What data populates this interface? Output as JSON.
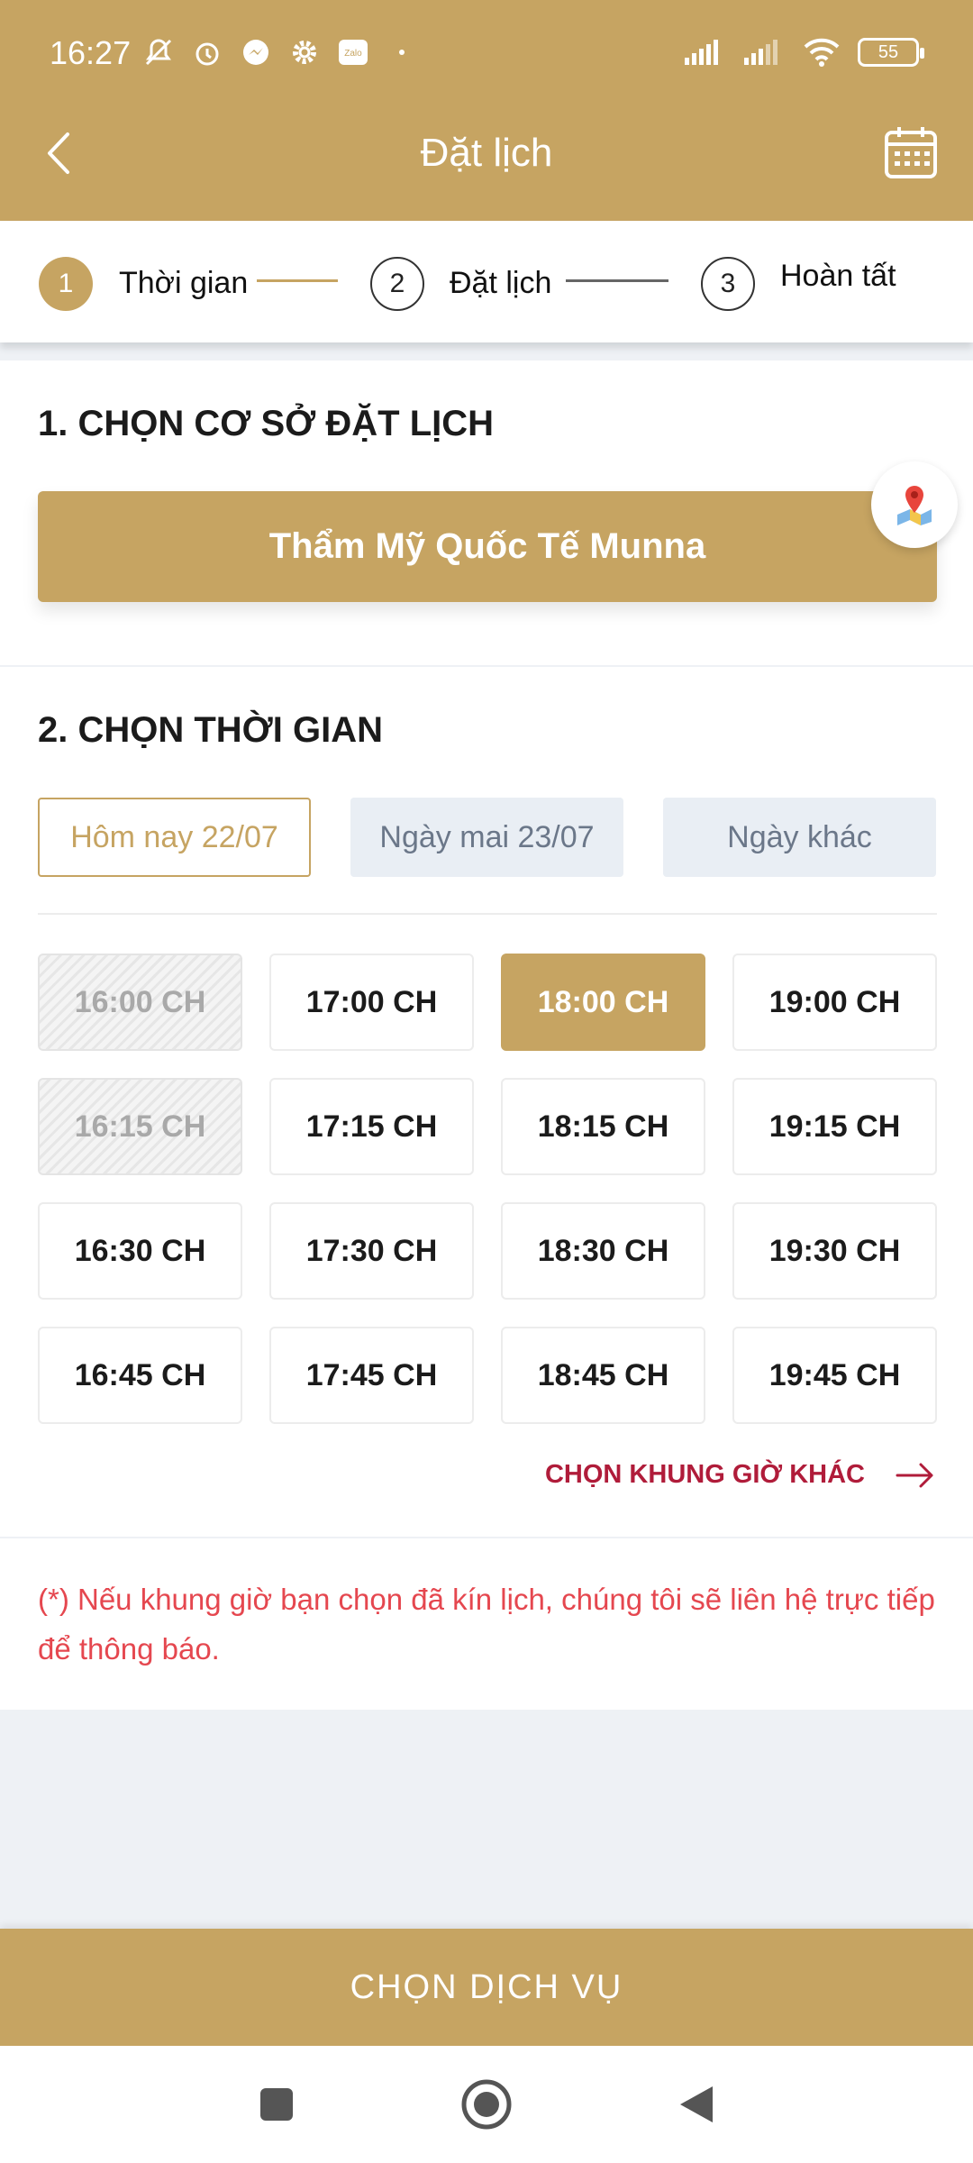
{
  "status_bar": {
    "time": "16:27",
    "battery": "55",
    "icons": [
      "mute-icon",
      "alarm-icon",
      "messenger-icon",
      "settings-icon",
      "zalo-icon",
      "dot-icon"
    ],
    "right_icons": [
      "signal-icon",
      "signal-icon",
      "wifi-icon",
      "battery-icon"
    ],
    "zalo_label": "Zalo"
  },
  "header": {
    "title": "Đặt lịch",
    "back_icon": "chevron-left-icon",
    "calendar_icon": "calendar-icon"
  },
  "stepper": {
    "steps": [
      {
        "number": "1",
        "label": "Thời gian",
        "state": "active"
      },
      {
        "number": "2",
        "label": "Đặt lịch",
        "state": "idle"
      },
      {
        "number": "3",
        "label": "Hoàn tất",
        "state": "idle"
      }
    ]
  },
  "branch_section": {
    "title": "1. CHỌN CƠ SỞ ĐẶT LỊCH",
    "branch_name": "Thẩm Mỹ Quốc Tế Munna",
    "map_icon": "map-pin-icon"
  },
  "time_section": {
    "title": "2. CHỌN THỜI GIAN",
    "days": [
      {
        "label": "Hôm nay 22/07",
        "state": "selected"
      },
      {
        "label": "Ngày mai 23/07",
        "state": "other"
      },
      {
        "label": "Ngày khác",
        "state": "other"
      }
    ],
    "slots": [
      {
        "label": "16:00 CH",
        "state": "disabled"
      },
      {
        "label": "17:00 CH",
        "state": "available"
      },
      {
        "label": "18:00 CH",
        "state": "selected"
      },
      {
        "label": "19:00 CH",
        "state": "available"
      },
      {
        "label": "16:15 CH",
        "state": "disabled"
      },
      {
        "label": "17:15 CH",
        "state": "available"
      },
      {
        "label": "18:15 CH",
        "state": "available"
      },
      {
        "label": "19:15 CH",
        "state": "available"
      },
      {
        "label": "16:30 CH",
        "state": "available"
      },
      {
        "label": "17:30 CH",
        "state": "available"
      },
      {
        "label": "18:30 CH",
        "state": "available"
      },
      {
        "label": "19:30 CH",
        "state": "available"
      },
      {
        "label": "16:45 CH",
        "state": "available"
      },
      {
        "label": "17:45 CH",
        "state": "available"
      },
      {
        "label": "18:45 CH",
        "state": "available"
      },
      {
        "label": "19:45 CH",
        "state": "available"
      }
    ],
    "more_label": "CHỌN KHUNG GIỜ KHÁC",
    "more_icon": "arrow-right-icon"
  },
  "note": {
    "text": "(*) Nếu khung giờ bạn chọn đã kín lịch, chúng tôi sẽ liên hệ trực tiếp để thông báo."
  },
  "cta": {
    "label": "CHỌN DỊCH VỤ"
  },
  "nav_bar": {
    "icons": [
      "recents-icon",
      "home-icon",
      "back-icon"
    ]
  },
  "colors": {
    "brand": "#c6a462",
    "warning": "#e5474f",
    "link": "#b01c3a",
    "tab_inactive_bg": "#e9eef4"
  }
}
